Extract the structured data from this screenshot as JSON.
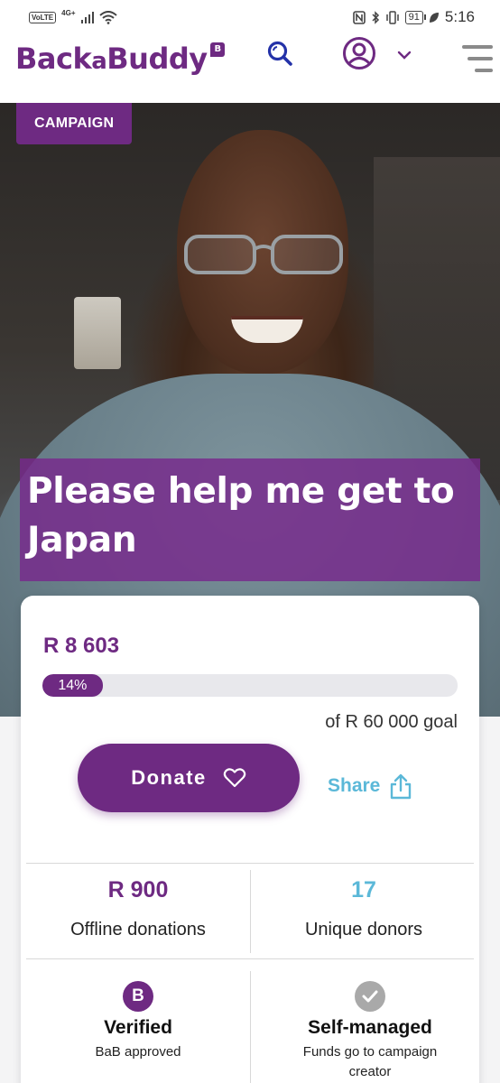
{
  "status_bar": {
    "network": "VoLTE",
    "network_type": "4G+",
    "battery": "91",
    "time": "5:16"
  },
  "header": {
    "logo_text_1": "Back",
    "logo_text_a": "a",
    "logo_text_2": "Buddy",
    "logo_badge": "B",
    "brand_color": "#6e2a82",
    "icons": [
      "search-icon",
      "user-icon",
      "chevron-down-icon",
      "menu-icon"
    ]
  },
  "hero": {
    "tag": "CAMPAIGN",
    "title": "Please help me get to Japan"
  },
  "campaign": {
    "raised": "R 8 603",
    "progress_label": "14%",
    "progress_fraction": 0.14,
    "goal_text": "of R 60 000 goal",
    "donate_label": "Donate",
    "share_label": "Share"
  },
  "stats": {
    "offline_value": "R 900",
    "offline_label": "Offline donations",
    "offline_color": "#6e2a82",
    "donors_value": "17",
    "donors_label": "Unique donors",
    "donors_color": "#5bb8d8"
  },
  "badges": {
    "verified_icon_letter": "B",
    "verified_title": "Verified",
    "verified_sub": "BaB approved",
    "self_title": "Self-managed",
    "self_sub": "Funds go to campaign creator"
  }
}
